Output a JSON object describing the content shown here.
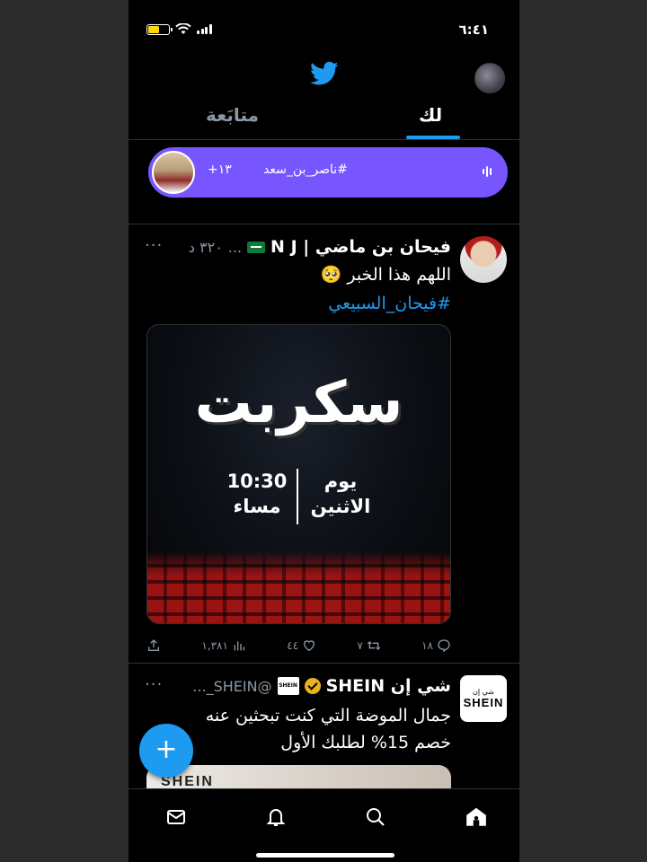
{
  "status_bar": {
    "time": "٦:٤١",
    "battery_color": "#ffd60a"
  },
  "tabs": {
    "for_you": "لك",
    "following": "متابَعة"
  },
  "space": {
    "title": "#ناصر_بن_سعد",
    "listeners": "+١٣",
    "color": "#7856ff"
  },
  "tweet1": {
    "display_name": "فيحان بن ماضي | N J",
    "handle": "...",
    "time": "٣٢٠ د",
    "text": "اللهم هذا الخبر 🥺",
    "hashtag": "#فيحان_السبيعي",
    "media": {
      "title": "سكربت",
      "day_line1": "يوم",
      "day_line2": "الاثنين",
      "time_line1": "10:30",
      "time_line2": "مساء"
    },
    "stats": {
      "replies": "١٨",
      "retweets": "٧",
      "likes": "٤٤",
      "views": "١,٣٨١"
    }
  },
  "tweet2": {
    "display_name": "شي إن SHEIN",
    "handle": "@SHEIN_...",
    "avatar_top": "شي إن",
    "avatar_logo": "SHEIN",
    "mini_logo": "SHEIN",
    "text_line1": "جمال الموضة التي كنت تبحثين عنه",
    "text_line2": "خصم 15% لطلبك الأول",
    "media_text": "SHEIN"
  },
  "fab": {
    "label": "+"
  },
  "colors": {
    "accent": "#1d9bf0",
    "background": "#000000",
    "divider": "#2f3336",
    "muted": "#8b98a5"
  },
  "nav": [
    "home-icon",
    "search-icon",
    "notifications-icon",
    "messages-icon"
  ]
}
